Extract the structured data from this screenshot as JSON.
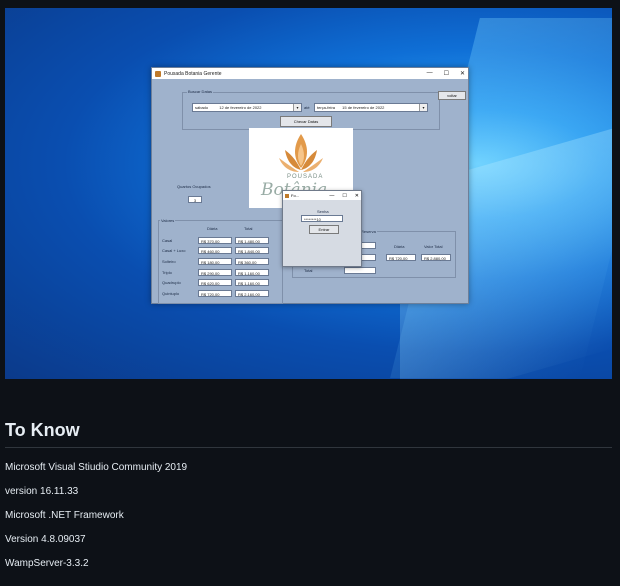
{
  "window": {
    "title": "Pousada Botania Gerente",
    "controls": [
      "—",
      "☐",
      "✕"
    ]
  },
  "search": {
    "group_label": "Buscar Datas",
    "from_day": "sábado",
    "from_date": "12 de fevereiro de 2022",
    "connector": "até",
    "to_day": "terça-feira",
    "to_date": "15 de fevereiro de 2022",
    "submit_label": "Checar Datas",
    "exit_label": "voltar"
  },
  "logo": {
    "text_top": "POUSADA",
    "text_bottom": "Botânia"
  },
  "rooms_available": {
    "label": "Quartos Ocupados",
    "value": "3"
  },
  "prices": {
    "group_label": "Valores",
    "col_daily": "Diária",
    "col_total": "Total",
    "rows": [
      {
        "name": "Casal",
        "daily": "R$ 370,00",
        "total": "R$ 1.480,00"
      },
      {
        "name": "Casal + Luxo",
        "daily": "R$ 460,00",
        "total": "R$ 1.840,00"
      },
      {
        "name": "Solteiro",
        "daily": "R$ 180,00",
        "total": "R$ 360,00"
      },
      {
        "name": "Triplo",
        "daily": "R$ 290,00",
        "total": "R$ 1.160,00"
      },
      {
        "name": "Quadruplo",
        "daily": "R$ 620,00",
        "total": "R$ 1.160,00"
      },
      {
        "name": "Quintuplo",
        "daily": "R$ 720,00",
        "total": "R$ 2.160,00"
      }
    ]
  },
  "reservation": {
    "group_label": "Reserva",
    "col_daily": "Diária",
    "col_total": "Valor Total",
    "daily_value": "R$ 720,00",
    "total_value": "R$ 2.880,00",
    "side_label": "Total"
  },
  "dialog": {
    "title": "Fo...",
    "controls": [
      "—",
      "☐",
      "✕"
    ],
    "field_label": "Senha",
    "field_value": "********10",
    "button_label": "Entrar"
  },
  "doc": {
    "heading": "To Know",
    "lines": [
      "Microsoft Visual Stiudio Community 2019",
      "version 16.11.33",
      "Microsoft .NET Framework",
      "Version 4.8.09037",
      "WampServer-3.3.2"
    ]
  }
}
